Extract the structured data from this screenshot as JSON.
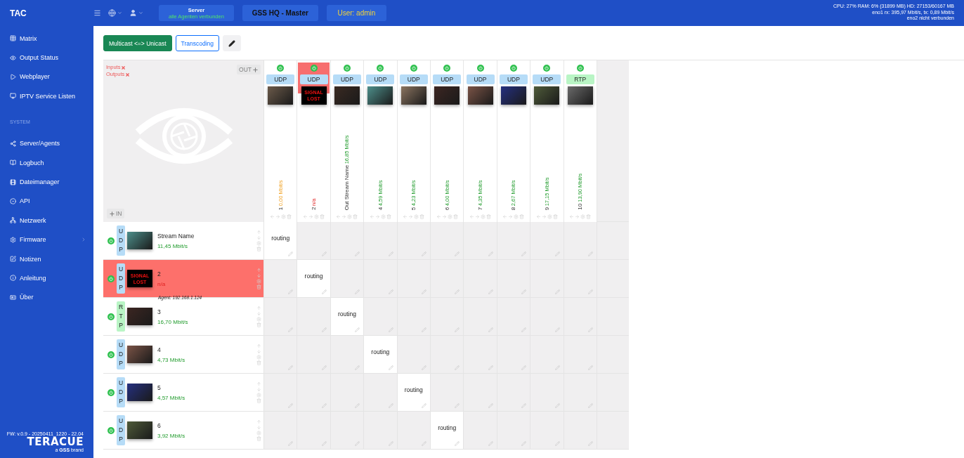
{
  "header": {
    "title": "TAC",
    "server": {
      "label": "Server",
      "status": "alle Agenten verbunden"
    },
    "site": "GSS HQ - Master",
    "user": "User: admin",
    "stats": [
      "CPU: 27% RAM: 6% (31899 MB) HD: 27153/60167 MB",
      "eno1 rx: 395,97 Mbit/s, tx: 0,89 Mbit/s",
      "eno2 nicht verbunden"
    ]
  },
  "sidebar": {
    "items": [
      {
        "kind": "item",
        "label": "Matrix"
      },
      {
        "kind": "item",
        "label": "Output Status"
      },
      {
        "kind": "item",
        "label": "Webplayer"
      },
      {
        "kind": "item",
        "label": "IPTV Service Listen"
      },
      {
        "kind": "section",
        "label": "SYSTEM"
      },
      {
        "kind": "item",
        "label": "Server/Agents"
      },
      {
        "kind": "item",
        "label": "Logbuch"
      },
      {
        "kind": "item",
        "label": "Dateimanager"
      },
      {
        "kind": "item",
        "label": "API"
      },
      {
        "kind": "item",
        "label": "Netzwerk"
      },
      {
        "kind": "submenu",
        "label": "Firmware"
      },
      {
        "kind": "item",
        "label": "Notizen"
      },
      {
        "kind": "item",
        "label": "Anleitung"
      },
      {
        "kind": "item",
        "label": "Über"
      }
    ],
    "firmware": "FW: v.0.9 - 20250411_1220 - 22.04",
    "brand": "TERACUE",
    "tagline": "a **GSS** brand"
  },
  "toolbar": {
    "buttons": [
      {
        "kind": "solid",
        "label": "Multicast <=> Unicast"
      },
      {
        "kind": "outline",
        "label": "Transcoding"
      },
      {
        "kind": "icon"
      }
    ]
  },
  "matrix": {
    "corner": {
      "inputs": "Inputs",
      "outputs": "Outputs",
      "out_button": "OUT",
      "in_button": "IN"
    },
    "columns": [
      {
        "label": "1",
        "protocol": "UDP",
        "bitrate": "0,00 Mbit/s",
        "no_traffic": true,
        "signal_lost": false
      },
      {
        "label": "2",
        "protocol": "UDP",
        "bitrate": "n/a",
        "no_traffic": false,
        "signal_lost": true,
        "thumb_text": "SIGNAL LOST"
      },
      {
        "label": "Out Stream Name",
        "protocol": "UDP",
        "bitrate": "16,85 Mbit/s",
        "no_traffic": false,
        "signal_lost": false
      },
      {
        "label": "4",
        "protocol": "UDP",
        "bitrate": "4,59 Mbit/s",
        "no_traffic": false,
        "signal_lost": false
      },
      {
        "label": "5",
        "protocol": "UDP",
        "bitrate": "4,23 Mbit/s",
        "no_traffic": false,
        "signal_lost": false
      },
      {
        "label": "6",
        "protocol": "UDP",
        "bitrate": "4,00 Mbit/s",
        "no_traffic": false,
        "signal_lost": false
      },
      {
        "label": "7",
        "protocol": "UDP",
        "bitrate": "4,35 Mbit/s",
        "no_traffic": false,
        "signal_lost": false
      },
      {
        "label": "8",
        "protocol": "UDP",
        "bitrate": "2,67 Mbit/s",
        "no_traffic": false,
        "signal_lost": false
      },
      {
        "label": "9",
        "protocol": "UDP",
        "bitrate": "17,15 Mbit/s",
        "no_traffic": false,
        "signal_lost": false
      },
      {
        "label": "10",
        "protocol": "RTP",
        "bitrate": "13,90 Mbit/s",
        "no_traffic": false,
        "signal_lost": false
      }
    ],
    "rows": [
      {
        "label": "Stream Name",
        "protocol": "UDP",
        "bitrate": "11,45 Mbit/s",
        "no_traffic": false,
        "signal_lost": false,
        "cells": [
          {
            "routed": true,
            "text": "routing"
          },
          {
            "routed": false
          },
          {
            "routed": false
          },
          {
            "routed": false
          },
          {
            "routed": false
          },
          {
            "routed": false
          },
          {
            "routed": false
          },
          {
            "routed": false
          },
          {
            "routed": false
          },
          {
            "routed": false
          }
        ]
      },
      {
        "label": "2",
        "protocol": "UDP",
        "bitrate": "n/a",
        "no_traffic": false,
        "signal_lost": true,
        "thumb_text": "SIGNAL LOST",
        "agent": "Agent: 192.168.1.124",
        "cells": [
          {
            "routed": false
          },
          {
            "routed": true,
            "text": "routing"
          },
          {
            "routed": false
          },
          {
            "routed": false
          },
          {
            "routed": false
          },
          {
            "routed": false
          },
          {
            "routed": false
          },
          {
            "routed": false
          },
          {
            "routed": false
          },
          {
            "routed": false
          }
        ]
      },
      {
        "label": "3",
        "protocol": "RTP",
        "bitrate": "16,70 Mbit/s",
        "no_traffic": false,
        "signal_lost": false,
        "cells": [
          {
            "routed": false
          },
          {
            "routed": false
          },
          {
            "routed": true,
            "text": "routing"
          },
          {
            "routed": false
          },
          {
            "routed": false
          },
          {
            "routed": false
          },
          {
            "routed": false
          },
          {
            "routed": false
          },
          {
            "routed": false
          },
          {
            "routed": false
          }
        ]
      },
      {
        "label": "4",
        "protocol": "UDP",
        "bitrate": "4,73 Mbit/s",
        "no_traffic": false,
        "signal_lost": false,
        "cells": [
          {
            "routed": false
          },
          {
            "routed": false
          },
          {
            "routed": false
          },
          {
            "routed": true,
            "text": "routing"
          },
          {
            "routed": false
          },
          {
            "routed": false
          },
          {
            "routed": false
          },
          {
            "routed": false
          },
          {
            "routed": false
          },
          {
            "routed": false
          }
        ]
      },
      {
        "label": "5",
        "protocol": "UDP",
        "bitrate": "4,57 Mbit/s",
        "no_traffic": false,
        "signal_lost": false,
        "cells": [
          {
            "routed": false
          },
          {
            "routed": false
          },
          {
            "routed": false
          },
          {
            "routed": false
          },
          {
            "routed": true,
            "text": "routing"
          },
          {
            "routed": false
          },
          {
            "routed": false
          },
          {
            "routed": false
          },
          {
            "routed": false
          },
          {
            "routed": false
          }
        ]
      },
      {
        "label": "6",
        "protocol": "UDP",
        "bitrate": "3,92 Mbit/s",
        "no_traffic": false,
        "signal_lost": false,
        "cells": [
          {
            "routed": false
          },
          {
            "routed": false
          },
          {
            "routed": false
          },
          {
            "routed": false
          },
          {
            "routed": false
          },
          {
            "routed": true,
            "text": "routing"
          },
          {
            "routed": false
          },
          {
            "routed": false
          },
          {
            "routed": false
          },
          {
            "routed": false
          }
        ]
      }
    ]
  }
}
